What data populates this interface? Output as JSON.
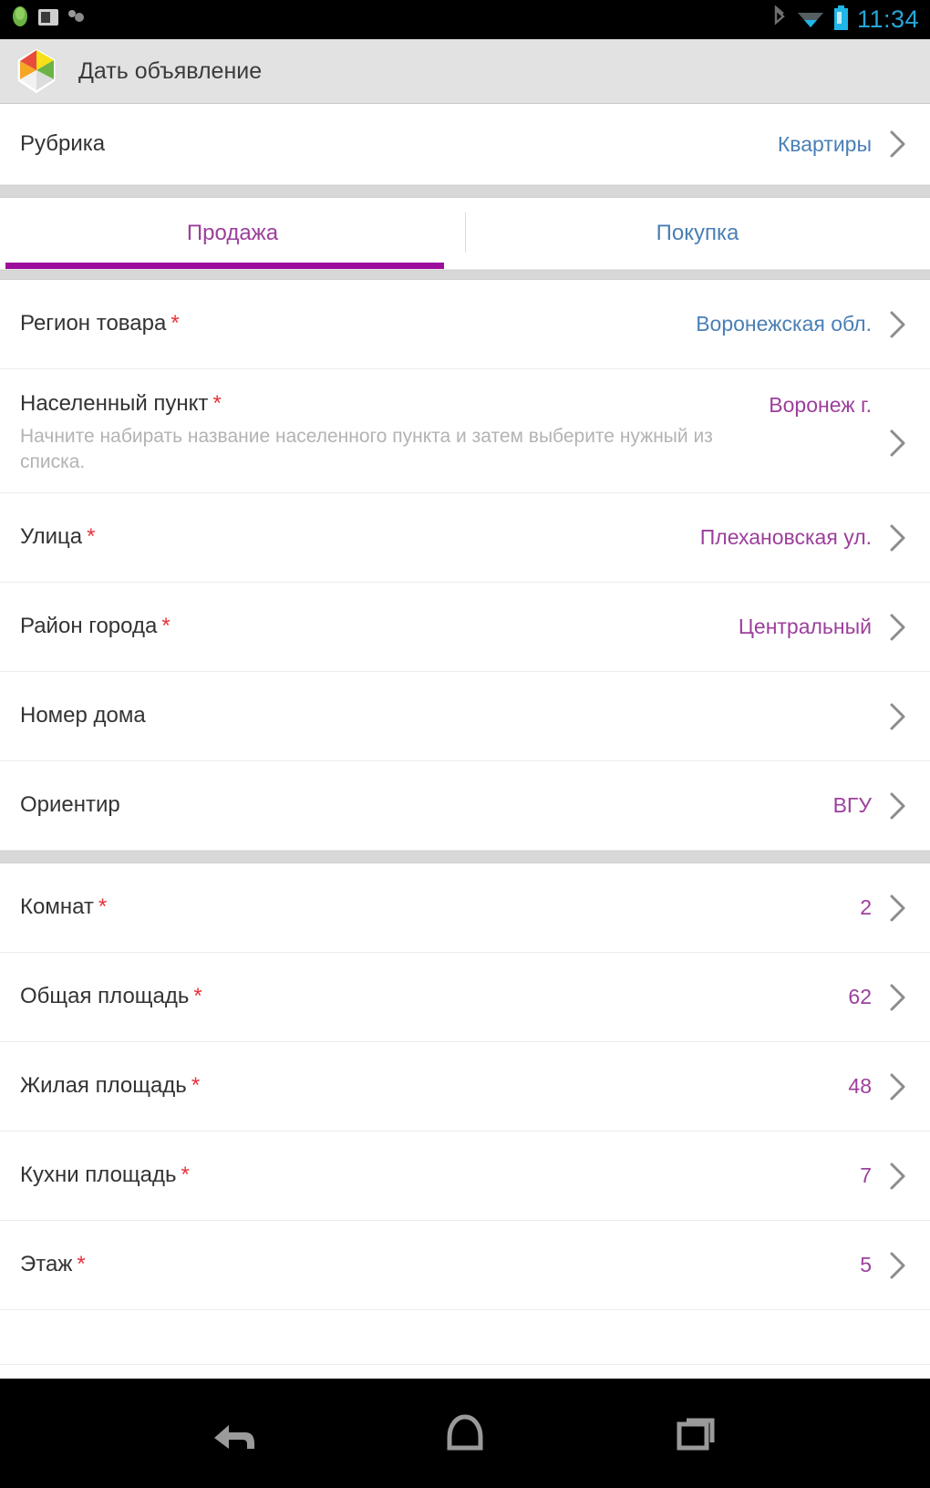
{
  "status_bar": {
    "time": "11:34",
    "icons": [
      "android-icon",
      "screenshot-icon",
      "apps-icon",
      "bluetooth-icon",
      "wifi-icon",
      "battery-icon"
    ]
  },
  "app_bar": {
    "title": "Дать объявление",
    "logo_icon": "app-logo-icon"
  },
  "category_row": {
    "label": "Рубрика",
    "value": "Квартиры",
    "chevron_icon": "chevron-right-icon"
  },
  "tabs": [
    {
      "label": "Продажа",
      "active": true
    },
    {
      "label": "Покупка",
      "active": false
    }
  ],
  "location_section": [
    {
      "label": "Регион товара",
      "required": "*",
      "value": "Воронежская обл.",
      "value_color": "blue",
      "hint": ""
    },
    {
      "label": "Населенный пункт",
      "required": "*",
      "value": "Воронеж г.",
      "value_color": "purple",
      "hint": "Начните набирать название населенного пункта и затем выберите нужный из списка."
    },
    {
      "label": "Улица",
      "required": "*",
      "value": "Плехановская ул.",
      "value_color": "purple",
      "hint": ""
    },
    {
      "label": "Район города",
      "required": "*",
      "value": "Центральный",
      "value_color": "purple",
      "hint": ""
    },
    {
      "label": "Номер дома",
      "required": "",
      "value": "",
      "value_color": "purple",
      "hint": ""
    },
    {
      "label": "Ориентир",
      "required": "",
      "value": "ВГУ",
      "value_color": "purple",
      "hint": ""
    }
  ],
  "property_section": [
    {
      "label": "Комнат",
      "required": "*",
      "value": "2",
      "value_color": "purple"
    },
    {
      "label": "Общая площадь",
      "required": "*",
      "value": "62",
      "value_color": "purple"
    },
    {
      "label": "Жилая площадь",
      "required": "*",
      "value": "48",
      "value_color": "purple"
    },
    {
      "label": "Кухни площадь",
      "required": "*",
      "value": "7",
      "value_color": "purple"
    },
    {
      "label": "Этаж",
      "required": "*",
      "value": "5",
      "value_color": "purple"
    }
  ],
  "nav_bar": {
    "back_icon": "back-icon",
    "home_icon": "home-icon",
    "recents_icon": "recents-icon"
  },
  "colors": {
    "accent_purple": "#9c0f9c",
    "value_purple": "#9c3f9c",
    "value_blue": "#4a7fb5",
    "required_red": "#e8323c",
    "status_time": "#25a7d9",
    "appbar_bg": "#e2e2e2",
    "separator": "#d8d8d8"
  }
}
